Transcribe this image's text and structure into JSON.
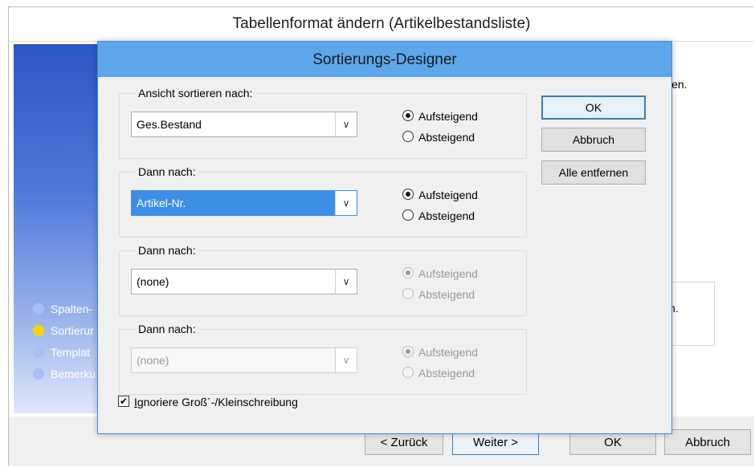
{
  "outer": {
    "title": "Tabellenformat ändern (Artikelbestandsliste)",
    "steps": [
      {
        "label": "Spalten-",
        "active": false
      },
      {
        "label": "Sortierur",
        "active": true
      },
      {
        "label": "Templat",
        "active": false
      },
      {
        "label": "Bemerku",
        "active": false
      }
    ],
    "text_top_fragment": "len.",
    "text_mid_fragment": "n.",
    "buttons": {
      "back": "< Zurück",
      "next": "Weiter >",
      "ok": "OK",
      "cancel": "Abbruch"
    }
  },
  "dialog": {
    "title": "Sortierungs-Designer",
    "groups": [
      {
        "label": "Ansicht sortieren nach:",
        "value": "Ges.Bestand",
        "state": "normal",
        "asc": "Aufsteigend",
        "desc": "Absteigend",
        "selected": "asc"
      },
      {
        "label": "Dann nach:",
        "value": "Artikel-Nr.",
        "state": "selected",
        "asc": "Aufsteigend",
        "desc": "Absteigend",
        "selected": "asc"
      },
      {
        "label": "Dann nach:",
        "value": "(none)",
        "state": "normal",
        "radios_disabled": true,
        "asc": "Aufsteigend",
        "desc": "Absteigend",
        "selected": "asc"
      },
      {
        "label": "Dann nach:",
        "value": "(none)",
        "state": "disabled",
        "radios_disabled": true,
        "asc": "Aufsteigend",
        "desc": "Absteigend",
        "selected": "asc"
      }
    ],
    "buttons": {
      "ok": "OK",
      "cancel": "Abbruch",
      "remove_all": "Alle entfernen"
    },
    "checkbox": {
      "label_underlined": "I",
      "label_rest": "gnoriere Groß´-/Kleinschreibung",
      "checked": true
    },
    "icons": {
      "dropdown": "chevron-down-icon",
      "check": "checkmark-icon"
    }
  }
}
